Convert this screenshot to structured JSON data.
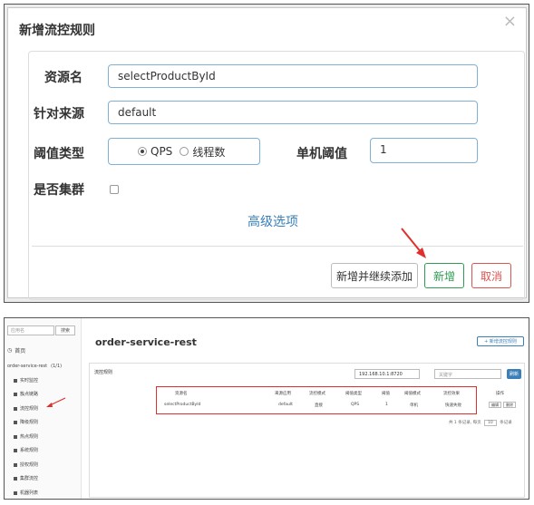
{
  "dialog": {
    "title": "新增流控规则",
    "close": "×",
    "resource_label": "资源名",
    "resource_value": "selectProductById",
    "source_label": "针对来源",
    "source_value": "default",
    "threshold_type_label": "阈值类型",
    "radio_qps": "QPS",
    "radio_threads": "线程数",
    "single_threshold_label": "单机阈值",
    "single_threshold_value": "1",
    "cluster_label": "是否集群",
    "advanced": "高级选项",
    "btn_add_continue": "新增并继续添加",
    "btn_add": "新增",
    "btn_cancel": "取消",
    "accent_green": "#2e9b52",
    "accent_red": "#d9534f",
    "arrow_color": "#e0302d"
  },
  "console": {
    "search_placeholder": "应用名",
    "search_button": "搜索",
    "home": "首页",
    "app_name": "order-service-rest",
    "app_count": "(1/1)",
    "menu": [
      "实时监控",
      "簇点链路",
      "流控规则",
      "降级规则",
      "热点规则",
      "系统规则",
      "授权规则",
      "集群流控",
      "机器列表"
    ],
    "title": "order-service-rest",
    "new_rule_button": "+ 新增流控规则",
    "card_title": "流控规则",
    "machine_select": "192.168.10.1:8720",
    "keyword_placeholder": "关键字",
    "search": "刷新",
    "table_headers": [
      "资源名",
      "来源应用",
      "流控模式",
      "阈值类型",
      "阈值",
      "阈值模式",
      "流控效果",
      "操作"
    ],
    "table_row": [
      "selectProductById",
      "default",
      "直接",
      "QPS",
      "1",
      "单机",
      "快速失败"
    ],
    "row_edit": "编辑",
    "row_delete": "删除",
    "pager_text": "共 1 条记录, 每页",
    "page_size": "10",
    "pager_tail": "条记录"
  }
}
